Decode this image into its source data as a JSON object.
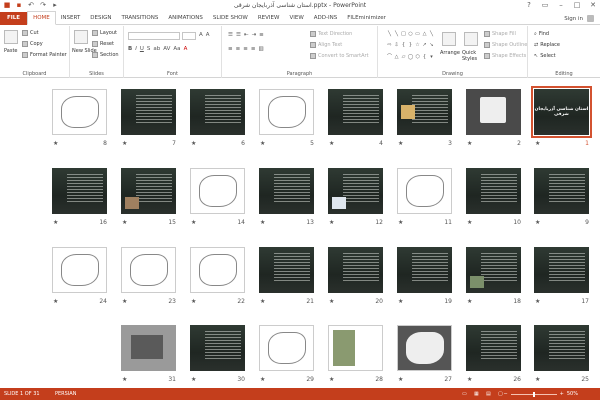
{
  "window": {
    "title": "استان شناسی آذربایجان شرقی.pptx - PowerPoint",
    "controls": [
      "?",
      "▭",
      "–",
      "□",
      "✕"
    ]
  },
  "tabs": [
    "FILE",
    "HOME",
    "INSERT",
    "DESIGN",
    "TRANSITIONS",
    "ANIMATIONS",
    "SLIDE SHOW",
    "REVIEW",
    "VIEW",
    "ADD-INS",
    "FILEminimizer"
  ],
  "active_tab": "HOME",
  "signin": "Sign in",
  "ribbon": {
    "clipboard": {
      "label": "Clipboard",
      "paste": "Paste",
      "cut": "Cut",
      "copy": "Copy",
      "format_painter": "Format Painter"
    },
    "slides": {
      "label": "Slides",
      "new_slide": "New Slide",
      "layout": "Layout",
      "reset": "Reset",
      "section": "Section"
    },
    "font": {
      "label": "Font",
      "row2": [
        "B",
        "I",
        "U",
        "S",
        "ab",
        "AV",
        "Aa",
        "A"
      ]
    },
    "paragraph": {
      "label": "Paragraph",
      "text_direction": "Text Direction",
      "align_text": "Align Text",
      "smartart": "Convert to SmartArt"
    },
    "drawing": {
      "label": "Drawing",
      "arrange": "Arrange",
      "quick_styles": "Quick Styles",
      "shape_fill": "Shape Fill",
      "shape_outline": "Shape Outline",
      "shape_effects": "Shape Effects"
    },
    "editing": {
      "label": "Editing",
      "find": "Find",
      "replace": "Replace",
      "select": "Select"
    }
  },
  "slides_title_text": "استان شناسی آذربایجان شرقی",
  "slide_numbers": [
    "1",
    "2",
    "3",
    "4",
    "5",
    "6",
    "7",
    "8",
    "9",
    "10",
    "11",
    "12",
    "13",
    "14",
    "15",
    "16",
    "17",
    "18",
    "19",
    "20",
    "21",
    "22",
    "23",
    "24",
    "25",
    "26",
    "27",
    "28",
    "29",
    "30",
    "31"
  ],
  "status": {
    "slide_info": "SLIDE 1 OF 31",
    "language": "PERSIAN",
    "zoom": "50%",
    "zoom_level": 0.5
  }
}
